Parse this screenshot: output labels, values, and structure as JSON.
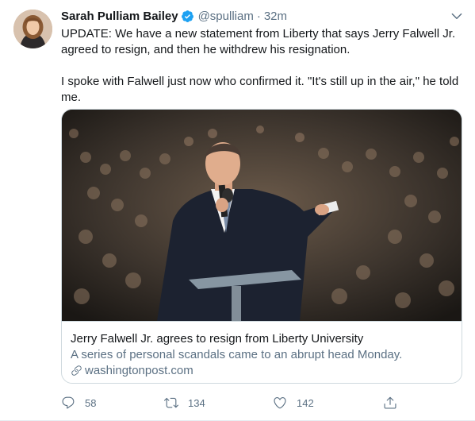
{
  "author": {
    "name": "Sarah Pulliam Bailey",
    "handle": "@spulliam",
    "separator": "·",
    "time": "32m"
  },
  "tweet": {
    "paragraph1": "UPDATE: We have a new statement from Liberty that says Jerry Falwell Jr. agreed to resign, and then he withdrew his resignation.",
    "paragraph2": "I spoke with Falwell just now who confirmed it. \"It's still up in the air,\" he told me."
  },
  "card": {
    "title": "Jerry Falwell Jr. agrees to resign from Liberty University",
    "description": "A series of personal scandals came to an abrupt head Monday.",
    "domain": "washingtonpost.com"
  },
  "actions": {
    "replies": "58",
    "retweets": "134",
    "likes": "142"
  },
  "colors": {
    "accent": "#1da1f2",
    "muted": "#5b7083"
  },
  "icons": [
    "verified-badge-icon",
    "chevron-down-icon",
    "link-icon",
    "reply-icon",
    "retweet-icon",
    "like-icon",
    "share-icon"
  ]
}
